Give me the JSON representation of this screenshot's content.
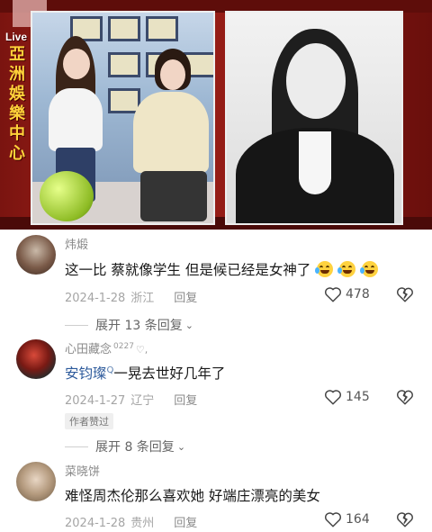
{
  "video": {
    "live_label": "Live",
    "channel_vertical": [
      "亞",
      "洲",
      "娛",
      "樂",
      "中",
      "心"
    ]
  },
  "comments": [
    {
      "username": "炜煅",
      "text": "这一比 蔡就像学生 但是候已经是女神了",
      "emojis": [
        "laughing-crying-emoji",
        "laughing-crying-emoji",
        "laughing-crying-emoji"
      ],
      "date": "2024-1-28",
      "location": "浙江",
      "reply_label": "回复",
      "likes": "478"
    },
    {
      "username": "心田藏念",
      "user_level": "0227",
      "mention": "安钧璨",
      "text": "一晃去世好几年了",
      "date": "2024-1-27",
      "location": "辽宁",
      "reply_label": "回复",
      "likes": "145",
      "badge": "作者赞过"
    },
    {
      "username": "菜晓饼",
      "text": "难怪周杰伦那么喜欢她 好端庄漂亮的美女",
      "date": "2024-1-28",
      "location": "贵州",
      "reply_label": "回复",
      "likes": "164"
    }
  ],
  "expand_replies": [
    {
      "label": "展开 13 条回复"
    },
    {
      "label": "展开 8 条回复"
    }
  ],
  "colors": {
    "mention": "#2e5b9c",
    "meta": "#a5a5a5",
    "video_bg": "#a8231a"
  }
}
